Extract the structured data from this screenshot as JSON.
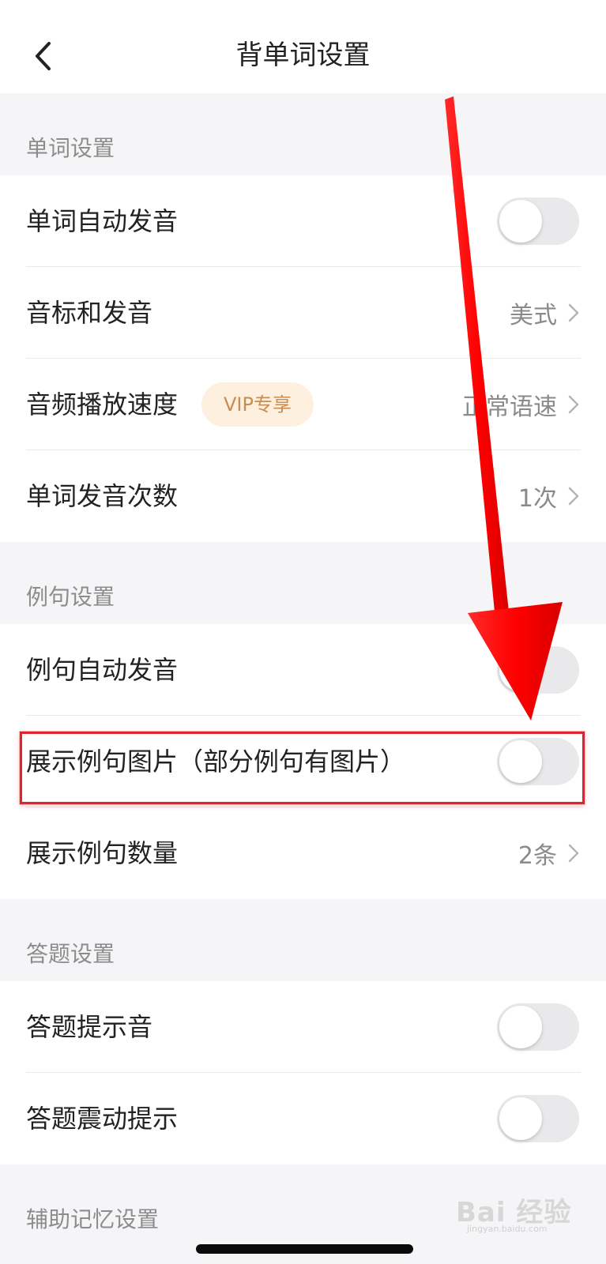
{
  "header": {
    "title": "背单词设置",
    "back_icon": "chevron-left-icon"
  },
  "sections": [
    {
      "title": "单词设置",
      "rows": [
        {
          "label": "单词自动发音",
          "control": "toggle",
          "on": false
        },
        {
          "label": "音标和发音",
          "control": "value",
          "value": "美式"
        },
        {
          "label": "音频播放速度",
          "control": "value",
          "value": "正常语速",
          "badge": "VIP专享"
        },
        {
          "label": "单词发音次数",
          "control": "value",
          "value": "1次"
        }
      ]
    },
    {
      "title": "例句设置",
      "rows": [
        {
          "label": "例句自动发音",
          "control": "toggle",
          "on": false
        },
        {
          "label": "展示例句图片（部分例句有图片）",
          "control": "toggle",
          "on": false,
          "highlighted": true
        },
        {
          "label": "展示例句数量",
          "control": "value",
          "value": "2条"
        }
      ]
    },
    {
      "title": "答题设置",
      "rows": [
        {
          "label": "答题提示音",
          "control": "toggle",
          "on": false
        },
        {
          "label": "答题震动提示",
          "control": "toggle",
          "on": false
        }
      ]
    },
    {
      "title": "辅助记忆设置",
      "rows": []
    }
  ],
  "annotation": {
    "arrow_color": "#ff0000",
    "highlight_color": "#e1242c"
  },
  "watermark": {
    "text": "Bai 经验",
    "sub": "jingyan.baidu.com"
  },
  "colors": {
    "background": "#f5f5f7",
    "toggle_off": "#e9e9eb",
    "vip_bg": "#fdf0de",
    "vip_text": "#c98d52"
  }
}
